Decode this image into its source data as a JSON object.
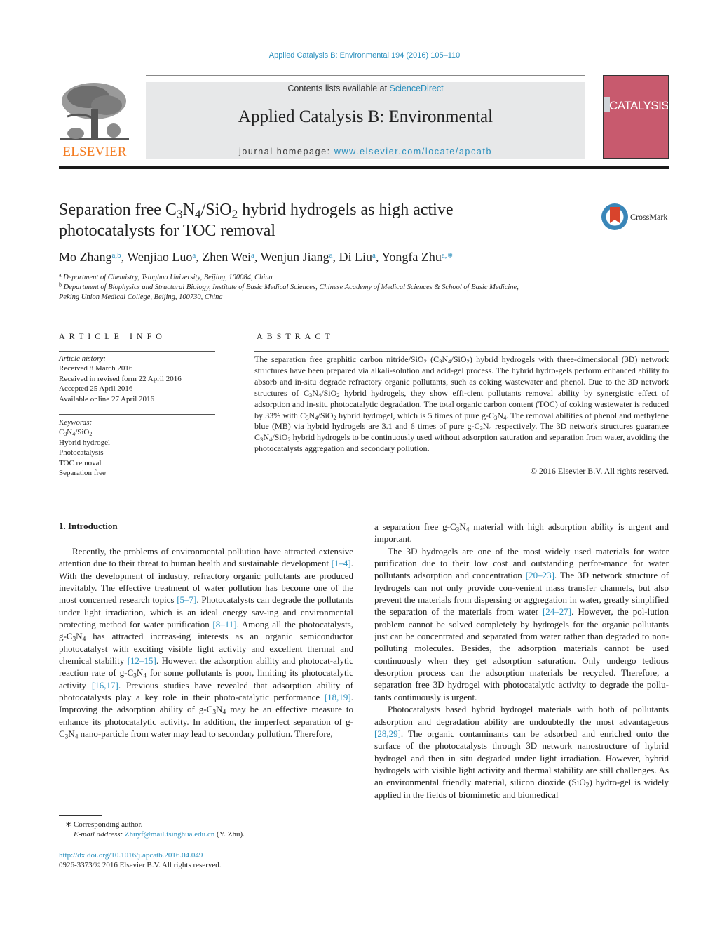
{
  "header": {
    "journal_ref": "Applied Catalysis B: Environmental 194 (2016) 105–110",
    "publisher_logo_text": "ELSEVIER",
    "contents_prefix": "Contents lists available at ",
    "contents_link": "ScienceDirect",
    "journal_title": "Applied Catalysis B: Environmental",
    "homepage_prefix": "journal homepage: ",
    "homepage_link": "www.elsevier.com/locate/apcatb",
    "cover_title": "CATALYSIS",
    "colors": {
      "link": "#2a8fbd",
      "elsevier_orange": "#f47b20",
      "cover_pink": "#c85a6e",
      "masthead_gray": "#e7e8e9"
    }
  },
  "article": {
    "title_line1_a": "Separation free C",
    "title_sub1": "3",
    "title_line1_b": "N",
    "title_sub2": "4",
    "title_line1_c": "/SiO",
    "title_sub3": "2",
    "title_line1_d": " hybrid hydrogels as high active",
    "title_line2": "photocatalysts for TOC removal",
    "crossmark_label": "CrossMark",
    "authors": [
      {
        "name": "Mo Zhang",
        "aff": "a,b"
      },
      {
        "name": "Wenjiao Luo",
        "aff": "a"
      },
      {
        "name": "Zhen Wei",
        "aff": "a"
      },
      {
        "name": "Wenjun Jiang",
        "aff": "a"
      },
      {
        "name": "Di Liu",
        "aff": "a"
      },
      {
        "name": "Yongfa Zhu",
        "aff": "a,∗"
      }
    ],
    "affiliations": [
      {
        "key": "a",
        "text": "Department of Chemistry, Tsinghua University, Beijing, 100084, China"
      },
      {
        "key": "b",
        "text": "Department of Biophysics and Structural Biology, Institute of Basic Medical Sciences, Chinese Academy of Medical Sciences & School of Basic Medicine,",
        "text2": "Peking Union Medical College, Beijing, 100730, China"
      }
    ]
  },
  "article_info": {
    "heading": "ARTICLE INFO",
    "history_label": "Article history:",
    "history": [
      "Received 8 March 2016",
      "Received in revised form 22 April 2016",
      "Accepted 25 April 2016",
      "Available online 27 April 2016"
    ],
    "keywords_label": "Keywords:",
    "keywords": [
      "C3N4/SiO2",
      "Hybrid hydrogel",
      "Photocatalysis",
      "TOC removal",
      "Separation free"
    ]
  },
  "abstract": {
    "heading": "ABSTRACT",
    "copyright": "© 2016 Elsevier B.V. All rights reserved."
  },
  "intro": {
    "heading": "1.  Introduction",
    "citations": [
      "[1–4]",
      "[5–7]",
      "[8–11]",
      "[12–15]",
      "[16,17]",
      "[18,19]",
      "[20–23]",
      "[24–27]",
      "[28,29]"
    ]
  },
  "footer": {
    "corresponding": "∗  Corresponding author.",
    "email_label": "E-mail address: ",
    "email": "Zhuyf@mail.tsinghua.edu.cn",
    "email_suffix": " (Y. Zhu).",
    "doi": "http://dx.doi.org/10.1016/j.apcatb.2016.04.049",
    "issn_line": "0926-3373/© 2016 Elsevier B.V. All rights reserved."
  }
}
